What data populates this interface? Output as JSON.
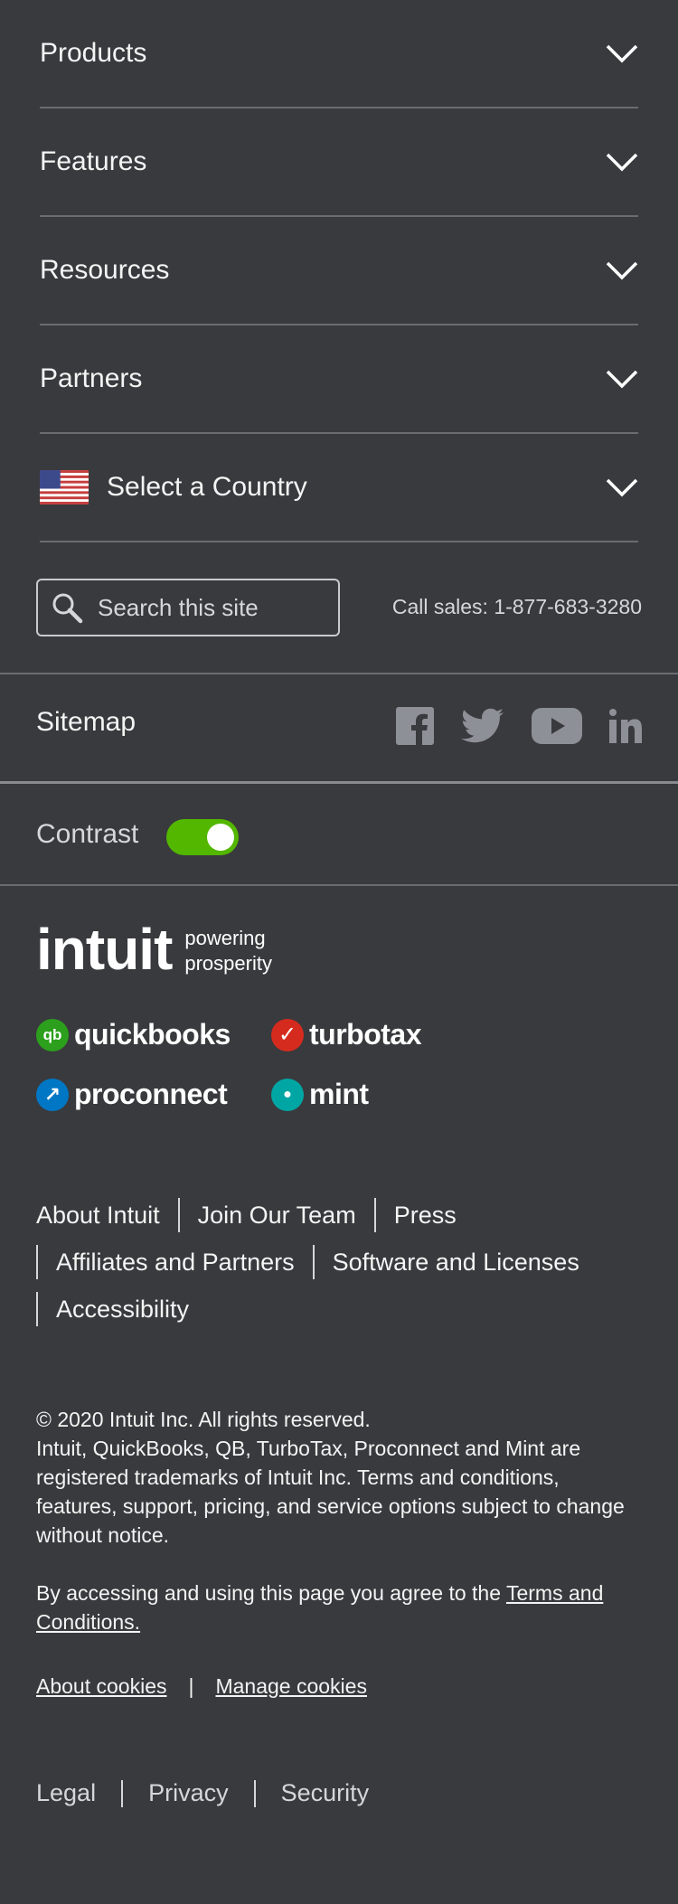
{
  "nav": {
    "items": [
      {
        "label": "Products"
      },
      {
        "label": "Features"
      },
      {
        "label": "Resources"
      },
      {
        "label": "Partners"
      }
    ],
    "country": {
      "label": "Select a Country",
      "flag": "us-flag-icon"
    }
  },
  "search": {
    "placeholder": "Search this site"
  },
  "call_sales": "Call sales: 1-877-683-3280",
  "sitemap": "Sitemap",
  "social": [
    "facebook-icon",
    "twitter-icon",
    "youtube-icon",
    "linkedin-icon"
  ],
  "contrast": {
    "label": "Contrast",
    "enabled": true,
    "color": "#53b700"
  },
  "intuit": {
    "wordmark": "intuit",
    "tagline_1": "powering",
    "tagline_2": "prosperity"
  },
  "brands": [
    {
      "name": "quickbooks",
      "mark": "qb",
      "color": "#2ca01c"
    },
    {
      "name": "turbotax",
      "mark": "✓",
      "color": "#d52b1e"
    },
    {
      "name": "proconnect",
      "mark": "↗",
      "color": "#0077c5"
    },
    {
      "name": "mint",
      "mark": "●",
      "color": "#00a6a4"
    }
  ],
  "company_links": [
    "About Intuit",
    "Join Our Team",
    "Press",
    "Affiliates and Partners",
    "Software and Licenses",
    "Accessibility"
  ],
  "legal": {
    "copyright": "© 2020 Intuit Inc. All rights reserved.",
    "trademarks": "Intuit, QuickBooks, QB, TurboTax, Proconnect and Mint are registered trademarks of Intuit Inc. Terms and conditions, features, support, pricing, and service options subject to change without notice.",
    "agree_prefix": "By accessing and using this page you agree to the ",
    "agree_link": "Terms and Conditions."
  },
  "cookies": {
    "about": "About cookies",
    "separator": "|",
    "manage": "Manage cookies"
  },
  "bottom_links": [
    "Legal",
    "Privacy",
    "Security"
  ],
  "colors": {
    "background": "#393a3d",
    "divider": "#6b6c72",
    "text": "#f4f4f4"
  }
}
